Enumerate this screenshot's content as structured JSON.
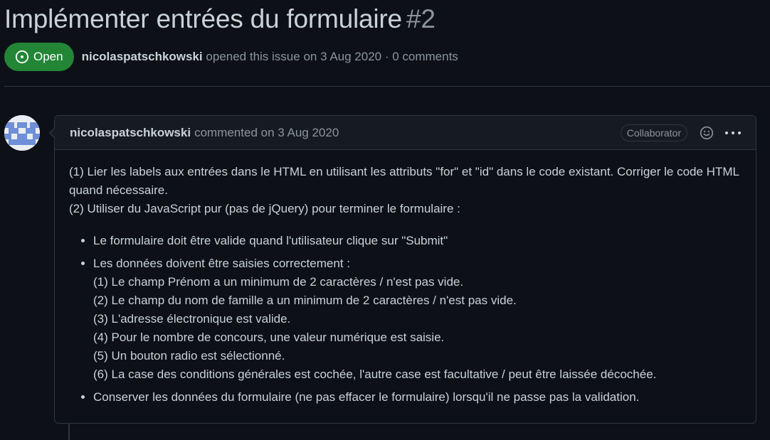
{
  "issue": {
    "title": "Implémenter entrées du formulaire",
    "number": "#2",
    "state": "Open",
    "author": "nicolaspatschkowski",
    "meta_text": "opened this issue on 3 Aug 2020 · 0 comments"
  },
  "comment": {
    "author": "nicolaspatschkowski",
    "action": "commented on 3 Aug 2020",
    "role_badge": "Collaborator",
    "icons": [
      "smiley-icon",
      "kebab-icon"
    ],
    "paragraphs": [
      "(1) Lier les labels aux entrées dans le HTML en utilisant les attributs \"for\" et \"id\" dans le code existant. Corriger le code HTML quand nécessaire.",
      "(2) Utiliser du JavaScript pur (pas de jQuery) pour terminer le formulaire :"
    ],
    "bullets": [
      "Le formulaire doit être valide quand l'utilisateur clique sur \"Submit\"",
      "Les données doivent être saisies correctement :",
      "Conserver les données du formulaire (ne pas effacer le formulaire) lorsqu'il ne passe pas la validation."
    ],
    "sub_items": [
      "(1) Le champ Prénom a un minimum de 2 caractères / n'est pas vide.",
      "(2) Le champ du nom de famille a un minimum de 2 caractères / n'est pas vide.",
      "(3) L'adresse électronique est valide.",
      "(4) Pour le nombre de concours, une valeur numérique est saisie.",
      "(5) Un bouton radio est sélectionné.",
      "(6) La case des conditions générales est cochée, l'autre case est facultative / peut être laissée décochée."
    ]
  },
  "colors": {
    "background": "#0d1117",
    "open_badge": "#238636",
    "border": "#30363d",
    "text": "#c9d1d9",
    "muted": "#8b949e"
  }
}
